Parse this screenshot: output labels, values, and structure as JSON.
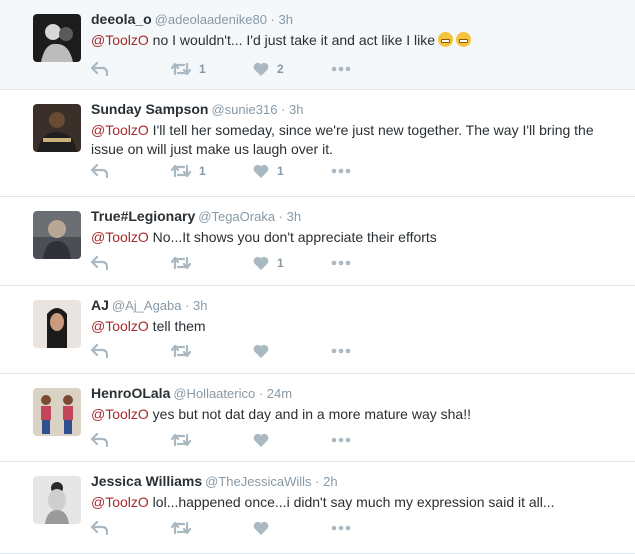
{
  "tweets": [
    {
      "name": "deeola_o",
      "handle": "@adeolaadenike80",
      "time": "3h",
      "mention": "@ToolzO",
      "text": " no I wouldn't... I'd just take it and act like I like",
      "emoji_count": 2,
      "retweets": "1",
      "likes": "2",
      "avatar_bg": "#1c1c1c"
    },
    {
      "name": "Sunday Sampson",
      "handle": "@sunie316",
      "time": "3h",
      "mention": "@ToolzO",
      "text": " I'll tell her someday, since we're just new together. The way I'll bring the issue on will just make us laugh over it.",
      "retweets": "1",
      "likes": "1",
      "avatar_bg": "#3b2f2a"
    },
    {
      "name": "True#Legionary",
      "handle": "@TegaOraka",
      "time": "3h",
      "mention": "@ToolzO",
      "text": " No...It shows you don't appreciate their efforts",
      "retweets": "",
      "likes": "1",
      "avatar_bg": "#6b6f74"
    },
    {
      "name": "AJ",
      "handle": "@Aj_Agaba",
      "time": "3h",
      "mention": "@ToolzO",
      "text": " tell them",
      "retweets": "",
      "likes": "",
      "avatar_bg": "#e9e4df"
    },
    {
      "name": "HenroOLala",
      "handle": "@Hollaaterico",
      "time": "24m",
      "mention": "@ToolzO",
      "text": " yes but not dat day and in a more mature way sha!!",
      "retweets": "",
      "likes": "",
      "avatar_bg": "#d9d2c5"
    },
    {
      "name": "Jessica Williams",
      "handle": "@TheJessicaWills",
      "time": "2h",
      "mention": "@ToolzO",
      "text": " lol...happened once...i didn't say much my expression said it all...",
      "retweets": "",
      "likes": "",
      "avatar_bg": "#e6e6e6"
    }
  ],
  "icons": {
    "reply": "reply-icon",
    "retweet": "retweet-icon",
    "like": "heart-icon",
    "more": "more-dots-icon"
  },
  "colors": {
    "mention": "#a42a2a",
    "muted": "#8899a6",
    "action_icon": "#aab8c2",
    "highlight_bg": "#f5f8fa"
  }
}
